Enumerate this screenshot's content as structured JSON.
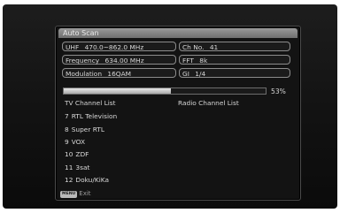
{
  "window": {
    "title": "Auto Scan"
  },
  "fields": {
    "uhf": {
      "label": "UHF",
      "value": "470.0~862.0 MHz"
    },
    "ch_no": {
      "label": "Ch No.",
      "value": "41"
    },
    "frequency": {
      "label": "Frequency",
      "value": "634.00 MHz"
    },
    "fft": {
      "label": "FFT",
      "value": "8k"
    },
    "modulation": {
      "label": "Modulation",
      "value": "16QAM"
    },
    "gi": {
      "label": "GI",
      "value": "1/4"
    }
  },
  "progress": {
    "value": 0.53,
    "label": "53%"
  },
  "lists": {
    "tv_header": "TV Channel List",
    "radio_header": "Radio Channel List",
    "tv_channels": [
      {
        "num": "7",
        "name": "RTL Television"
      },
      {
        "num": "8",
        "name": "Super RTL"
      },
      {
        "num": "9",
        "name": "VOX"
      },
      {
        "num": "10",
        "name": "ZDF"
      },
      {
        "num": "11",
        "name": "3sat"
      },
      {
        "num": "12",
        "name": "Doku/KiKa"
      }
    ],
    "radio_channels": []
  },
  "footer": {
    "key": "MENU",
    "label": "Exit"
  }
}
